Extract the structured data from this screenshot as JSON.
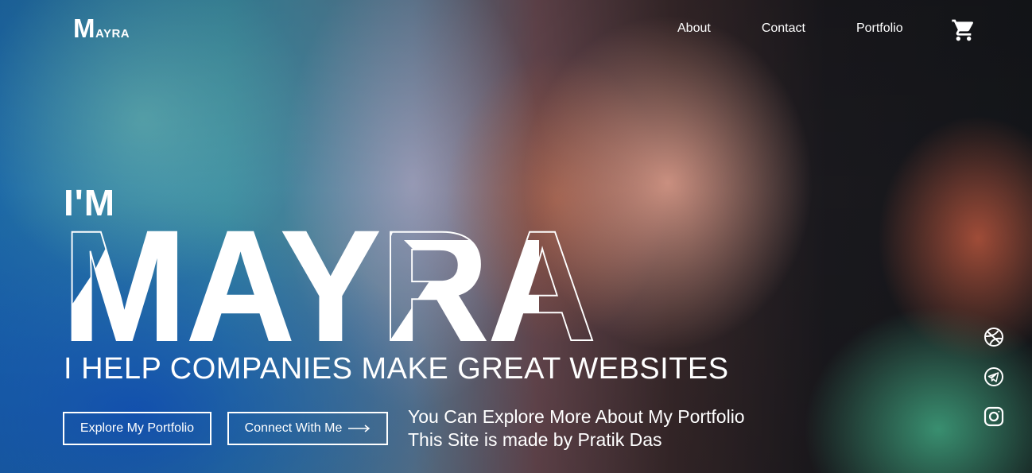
{
  "header": {
    "logo_first": "M",
    "logo_rest": "ayra",
    "nav": [
      "About",
      "Contact",
      "Portfolio"
    ],
    "cart_icon": "cart-icon"
  },
  "hero": {
    "im": "I'M",
    "name": "MAYRA",
    "tagline": "I HELP COMPANIES MAKE GREAT WEBSITES",
    "buttons": {
      "explore": "Explore My Portfolio",
      "connect": "Connect With Me"
    },
    "info_line1": "You Can Explore More About My Portfolio",
    "info_line2": "This Site is made by Pratik Das"
  },
  "social": [
    "dribbble-icon",
    "telegram-icon",
    "instagram-icon"
  ],
  "colors": {
    "text": "#ffffff",
    "accent_blue": "#1f6fb0"
  }
}
